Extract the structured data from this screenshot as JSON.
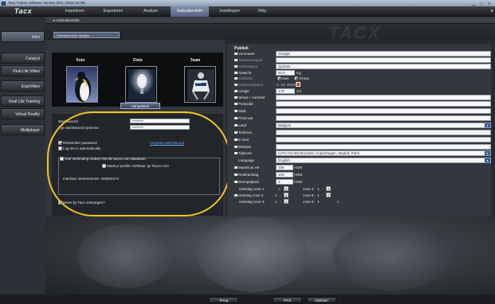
{
  "window": {
    "title": "Tacx Trainer software Version 2011 (2010 10:09)"
  },
  "app": {
    "logo": "Tacx"
  },
  "menu": [
    {
      "label": "Importeren"
    },
    {
      "label": "Exporteren"
    },
    {
      "label": "Analyse"
    },
    {
      "label": "Gebruikersinfo"
    },
    {
      "label": "Instellingen"
    },
    {
      "label": "Help"
    }
  ],
  "sidebar": [
    {
      "label": "Intro"
    },
    {
      "label": "Catalyst"
    },
    {
      "label": "Real Life Video"
    },
    {
      "label": "ErgoVideo"
    },
    {
      "label": "Real Life Training"
    },
    {
      "label": "Virtual Reality"
    },
    {
      "label": "Multiplayer"
    }
  ],
  "breadcrumb": "Gebruikersinfo",
  "tab": {
    "label": "Gebruikersinfo wijzigen"
  },
  "tiles": {
    "photo": "Foto",
    "bike": "Fiets",
    "team": "Team",
    "team_badge": "Tacx"
  },
  "upload_button": "Aanpassen",
  "account": {
    "password_label": "Wachtwoord",
    "password_value": "********",
    "repeat_label": "Typ wachtwoord opnieuw",
    "repeat_value": "********",
    "remember_label": "Remember password",
    "forgot_link": "Vergeten wachtwoord",
    "autologin_label": "Log me in automatically",
    "sync_label": "Ook verbinding maken met de tacxe.com databank.",
    "public_profile_label": "Maak je profiel zichtbaar op Tacxe.com",
    "serial_text": "Interface serienummer: 020602274",
    "newsletter_label": "News by Tacx ontvangen?"
  },
  "public": {
    "section_title": "Publiek",
    "first_name_label": "Voornaam",
    "first_name_value": "Giorgia",
    "middle_label": "Tussenvoegsel",
    "last_name_label": "Achternaam",
    "last_name_value": "Quintus",
    "weight_label": "Gewicht",
    "weight_value": "60.0",
    "weight_unit": "Kg",
    "gender_label": "Geslacht",
    "gender_male": "Man",
    "gender_female": "Vrouw",
    "birth_label": "Geboortedatum",
    "birth_value": "1- 12- 2010",
    "height_label": "Lengte",
    "height_value": "170",
    "height_unit": "cm",
    "street_label": "Straat + nummer",
    "postal_label": "Postcode",
    "city_label": "Stad",
    "province_label": "Provincie",
    "country_label": "Land",
    "country_value": "Belgium",
    "phone_label": "Telefoon",
    "email_label": "E-mail",
    "website_label": "Website",
    "timezone_label": "Tijdzone",
    "timezone_value": "(UTC+01:00) Brussels, Copenhagen, Madrid, Paris",
    "language_label": "Language",
    "language_value": "English",
    "maxhr_label": "Maximum HF",
    "maxhr_value": "190",
    "maxhr_unit": "HSM",
    "resthr_label": "Rusthartslag",
    "resthr_value": "100",
    "resthr_unit": "HSM",
    "threshold_label": "Drempelpunt",
    "threshold_value": "0",
    "threshold_unit": "HSM",
    "zones": {
      "row1_label": "Hartslag zone 1",
      "row2_label": "Hartslag zone 2",
      "row3_label": "Hartslag zone 3",
      "z1_from_prefix": "<",
      "z1_from": "0",
      "z4_label": "zone 4",
      "z4_from": "1",
      "z4_to": "0",
      "z2_from": "1",
      "z2_to": "0",
      "z5_label": "zone 5",
      "z5_from": "1",
      "z5_to": "0",
      "z3_from": "1",
      "z3_to": "0",
      "z6_label": "zone 6",
      "z6_from": "1",
      "z6_suffix": ">",
      "dash": "-"
    }
  },
  "bottom_buttons": {
    "back": "Terug",
    "print": "Print",
    "save": "Opslaan"
  },
  "colors": {
    "highlight_oval": "#f3c51d",
    "active_menu": "#6f7e9a",
    "accent_blue": "#2f5b9a"
  }
}
